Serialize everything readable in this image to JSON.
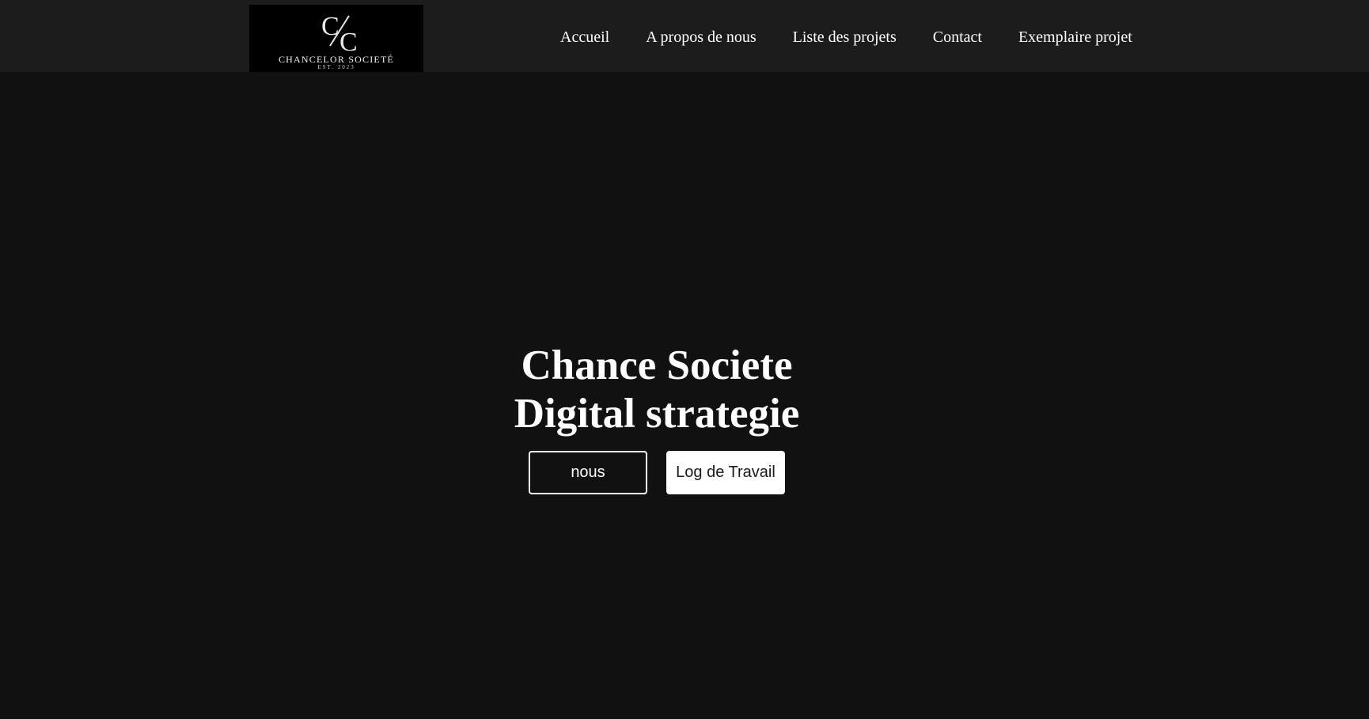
{
  "logo": {
    "name": "CHANCELOR SOCIETÉ",
    "est": "EST. 2023",
    "letter_top": "C",
    "letter_bottom": "C"
  },
  "nav": {
    "items": [
      {
        "label": "Accueil"
      },
      {
        "label": "A propos de nous"
      },
      {
        "label": "Liste des projets"
      },
      {
        "label": "Contact"
      },
      {
        "label": "Exemplaire projet"
      }
    ]
  },
  "hero": {
    "title_line1": "Chance Societe",
    "title_line2": "Digital strategie",
    "button_primary": "nous",
    "button_secondary": "Log de Travail"
  },
  "colors": {
    "page_background": "#111111",
    "navbar_background": "#1c1c1c",
    "text": "#ffffff",
    "logo_background": "#000000"
  }
}
